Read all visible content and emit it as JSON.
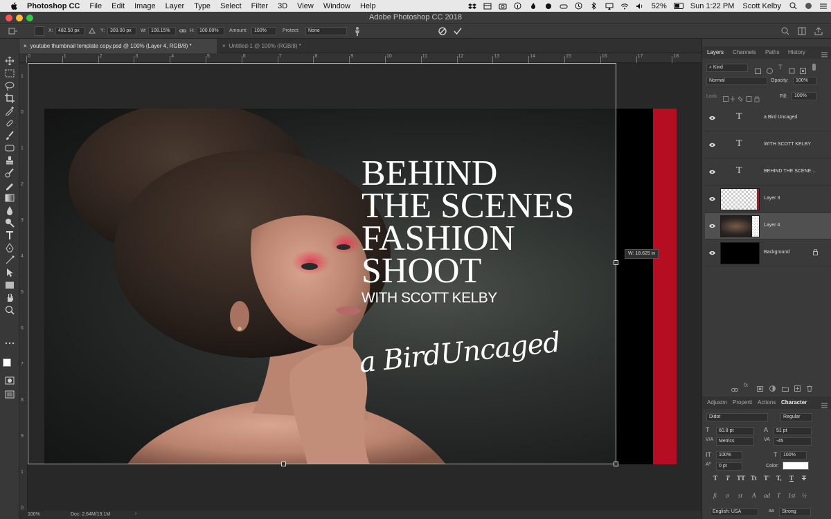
{
  "macmenu": {
    "app": "Photoshop CC",
    "items": [
      "File",
      "Edit",
      "Image",
      "Layer",
      "Type",
      "Select",
      "Filter",
      "3D",
      "View",
      "Window",
      "Help"
    ],
    "battery": "52%",
    "clock": "Sun 1:22 PM",
    "user": "Scott Kelby"
  },
  "window_title": "Adobe Photoshop CC 2018",
  "options": {
    "x_label": "X:",
    "x": "482.50 px",
    "y_label": "Y:",
    "y": "309.00 px",
    "w_label": "W:",
    "w": "108.15%",
    "h_label": "H:",
    "h": "100.00%",
    "amount_label": "Amount:",
    "amount": "100%",
    "protect_label": "Protect:",
    "protect": "None"
  },
  "tabs": [
    {
      "label": "youtube thumbnail template copy.psd @ 100% (Layer 4, RGB/8) *"
    },
    {
      "label": "Untitled-1 @ 100% (RGB/8) *"
    }
  ],
  "ruler": {
    "top": [
      "0",
      "1",
      "2",
      "3",
      "4",
      "5",
      "6",
      "7",
      "8",
      "9",
      "10",
      "11",
      "12",
      "13",
      "14",
      "15",
      "16",
      "17",
      "18"
    ],
    "left": [
      "1",
      "0",
      "1",
      "2",
      "3",
      "4",
      "5",
      "6",
      "7",
      "8",
      "9",
      "1",
      "0"
    ]
  },
  "thumbnail": {
    "title_lines": [
      "BEHIND",
      "THE SCENES",
      "FASHION",
      "SHOOT"
    ],
    "subtitle": "WITH SCOTT KELBY",
    "script": "a BirdUncaged",
    "stripe_color": "#b50d22"
  },
  "transform_readout": "W: 18.625 in",
  "status": {
    "zoom": "100%",
    "doc": "Doc: 2.64M/19.1M"
  },
  "panel": {
    "tabs": [
      "Layers",
      "Channels",
      "Paths",
      "History"
    ],
    "search_placeholder": "Kind",
    "blend_mode": "Normal",
    "opacity_label": "Opacity:",
    "opacity": "100%",
    "lock_label": "Lock:",
    "fill_label": "Fill:",
    "fill": "100%",
    "layers": [
      {
        "name": "a Bird Uncaged",
        "kind": "text"
      },
      {
        "name": "WITH SCOTT KELBY",
        "kind": "text"
      },
      {
        "name": "BEHIND THE SCENE...",
        "kind": "text"
      },
      {
        "name": "Layer 3",
        "kind": "pixel"
      },
      {
        "name": "Layer 4",
        "kind": "photo",
        "selected": true
      },
      {
        "name": "Background",
        "kind": "fill"
      }
    ]
  },
  "char_panel": {
    "tabs": [
      "Adjustm",
      "Properti",
      "Actions",
      "Character"
    ],
    "font": "Didot",
    "style": "Regular",
    "size": "60.8 pt",
    "leading": "51 pt",
    "kerning": "Metrics",
    "tracking": "-45",
    "vscale": "100%",
    "hscale": "100%",
    "baseline": "0 pt",
    "color_label": "Color:",
    "lang": "English: USA",
    "aa": "Strong",
    "style_buttons": [
      "T",
      "T",
      "TT",
      "Tt",
      "T'",
      "T,",
      "T",
      "T"
    ],
    "ot_buttons": [
      "fi",
      "σ",
      "st",
      "A",
      "ad",
      "T",
      "1st",
      "½"
    ]
  }
}
